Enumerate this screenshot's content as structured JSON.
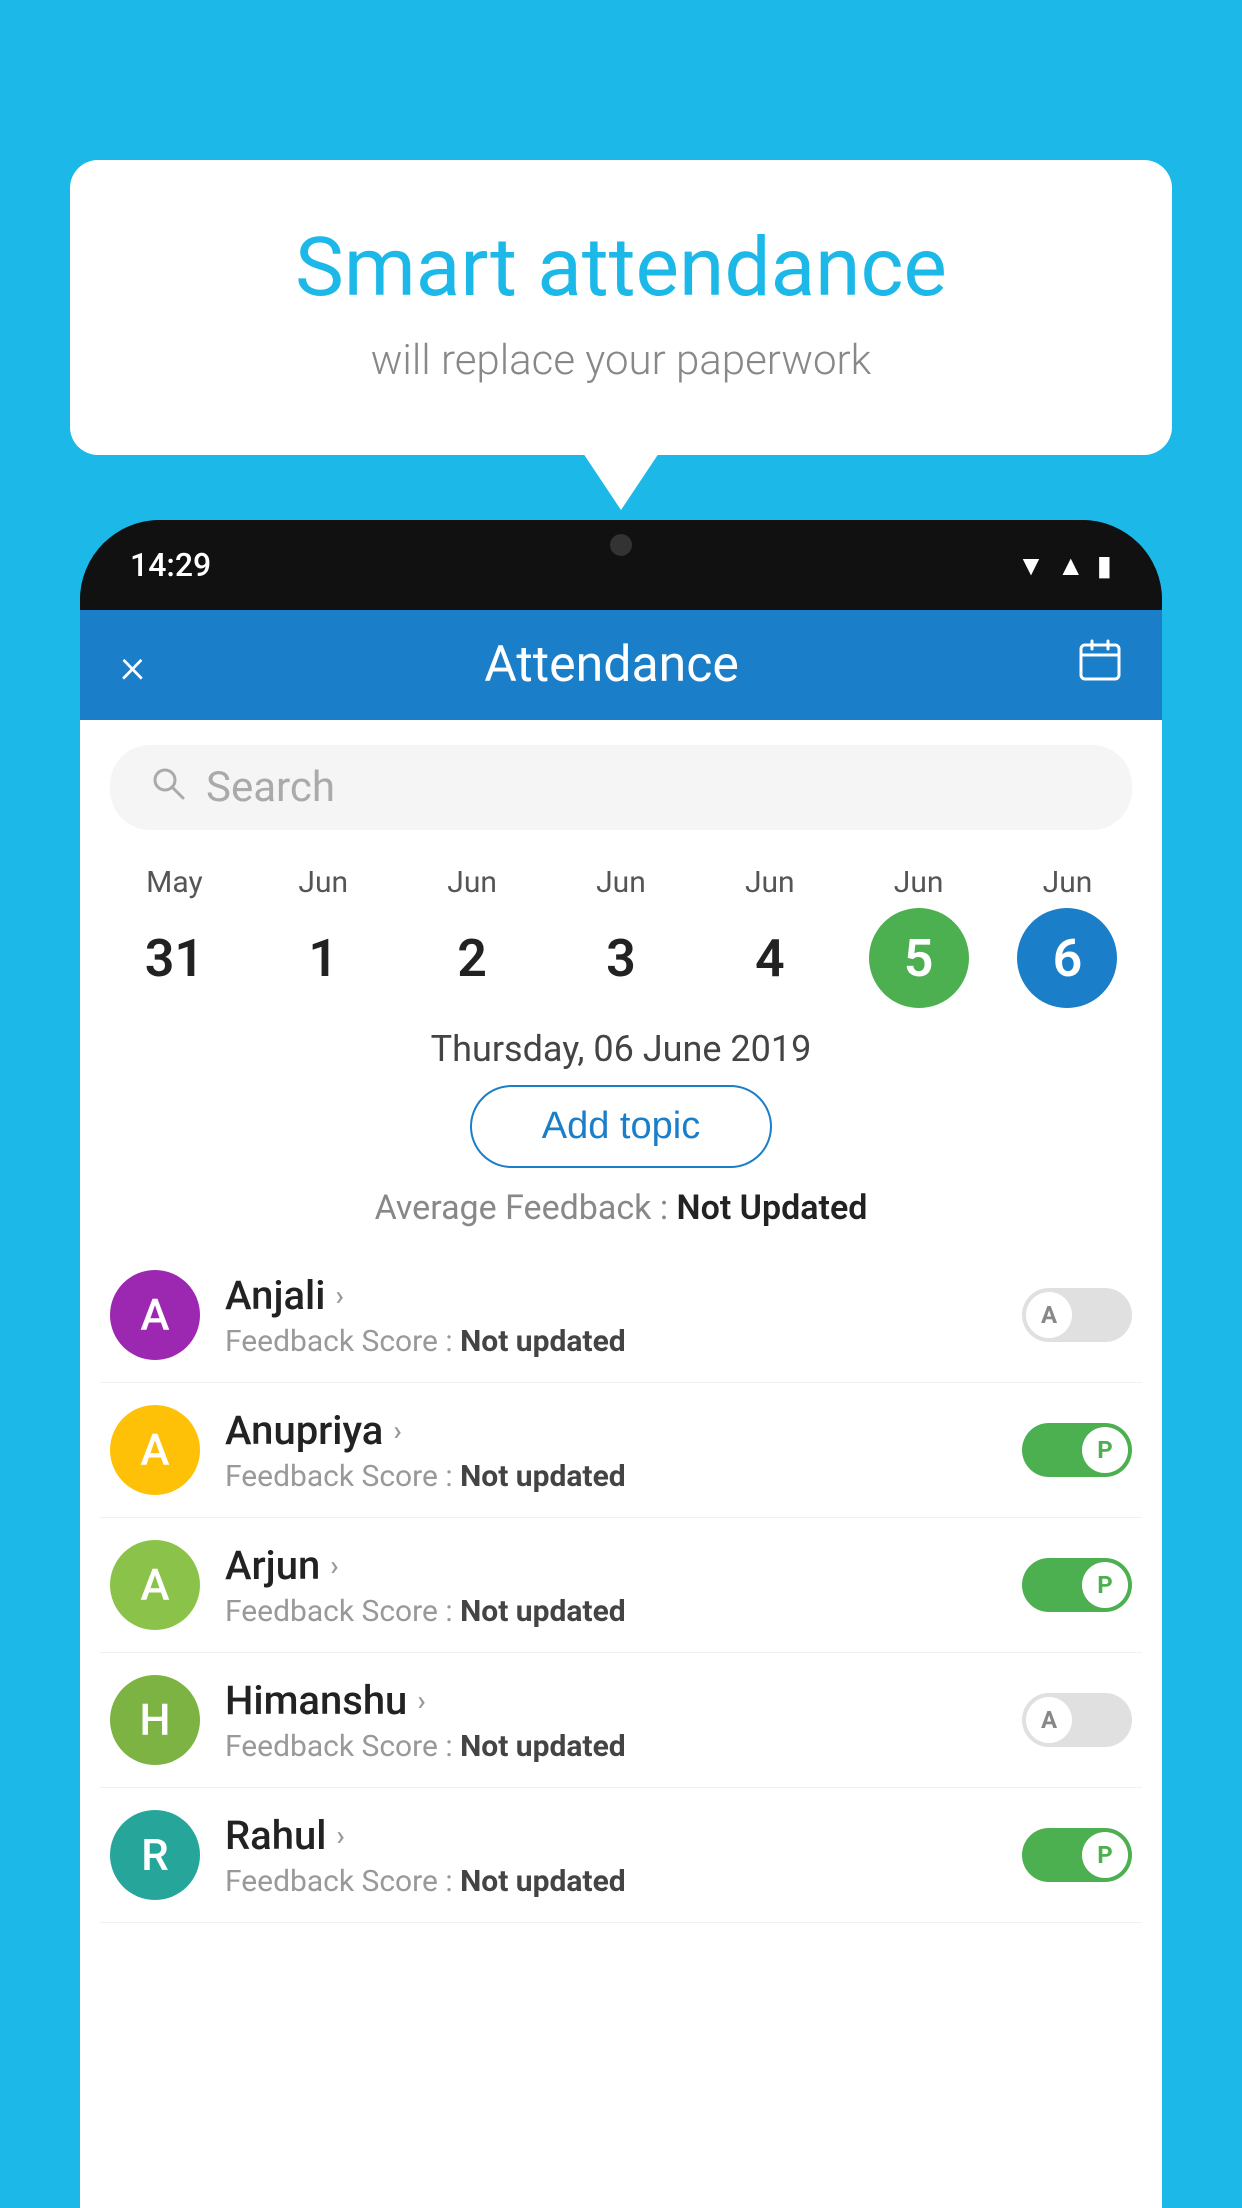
{
  "background": {
    "color": "#1BB8E8"
  },
  "speech_bubble": {
    "title": "Smart attendance",
    "subtitle": "will replace your paperwork"
  },
  "phone": {
    "status_bar": {
      "time": "14:29",
      "icons": [
        "wifi",
        "signal",
        "battery"
      ]
    },
    "header": {
      "close_label": "×",
      "title": "Attendance",
      "calendar_icon": "📅"
    },
    "search": {
      "placeholder": "Search"
    },
    "calendar": {
      "dates": [
        {
          "month": "May",
          "day": "31",
          "state": "normal"
        },
        {
          "month": "Jun",
          "day": "1",
          "state": "normal"
        },
        {
          "month": "Jun",
          "day": "2",
          "state": "normal"
        },
        {
          "month": "Jun",
          "day": "3",
          "state": "normal"
        },
        {
          "month": "Jun",
          "day": "4",
          "state": "normal"
        },
        {
          "month": "Jun",
          "day": "5",
          "state": "today"
        },
        {
          "month": "Jun",
          "day": "6",
          "state": "selected"
        }
      ]
    },
    "selected_date_label": "Thursday, 06 June 2019",
    "add_topic_label": "Add topic",
    "avg_feedback_prefix": "Average Feedback : ",
    "avg_feedback_value": "Not Updated",
    "students": [
      {
        "name": "Anjali",
        "avatar_letter": "A",
        "avatar_color": "purple",
        "feedback_label": "Feedback Score : ",
        "feedback_value": "Not updated",
        "toggle_state": "off",
        "toggle_letter": "A"
      },
      {
        "name": "Anupriya",
        "avatar_letter": "A",
        "avatar_color": "yellow",
        "feedback_label": "Feedback Score : ",
        "feedback_value": "Not updated",
        "toggle_state": "on",
        "toggle_letter": "P"
      },
      {
        "name": "Arjun",
        "avatar_letter": "A",
        "avatar_color": "light-green",
        "feedback_label": "Feedback Score : ",
        "feedback_value": "Not updated",
        "toggle_state": "on",
        "toggle_letter": "P"
      },
      {
        "name": "Himanshu",
        "avatar_letter": "H",
        "avatar_color": "green-darker",
        "feedback_label": "Feedback Score : ",
        "feedback_value": "Not updated",
        "toggle_state": "off",
        "toggle_letter": "A"
      },
      {
        "name": "Rahul",
        "avatar_letter": "R",
        "avatar_color": "teal",
        "feedback_label": "Feedback Score : ",
        "feedback_value": "Not updated",
        "toggle_state": "on",
        "toggle_letter": "P"
      }
    ]
  }
}
